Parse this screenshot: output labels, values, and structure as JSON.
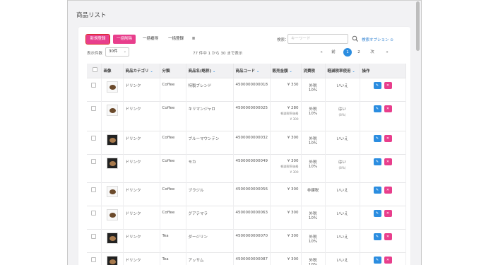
{
  "page_title": "商品リスト",
  "toolbar": {
    "new_label": "新規登録",
    "bulk_delete_label": "一括削除",
    "bulk_edit_label": "一括複得",
    "bulk_register_label": "一括登録",
    "columns_label": "Ⅲ"
  },
  "search": {
    "label": "検索：",
    "placeholder": "キーワード",
    "options_label": "検索オプション"
  },
  "per_page": {
    "label": "表示件数",
    "value": "30件"
  },
  "result_count": "77 件中 1 から 30 まで表示",
  "pagination": {
    "first": "«",
    "prev": "前",
    "pages": [
      "1",
      "2"
    ],
    "next": "次",
    "last": "»"
  },
  "table": {
    "headers": [
      "",
      "画像",
      "商品カテゴリ",
      "分類",
      "商品名(略称)",
      "商品コード",
      "販売金額",
      "消費税",
      "軽減税率使用",
      "操作"
    ],
    "rows": [
      {
        "category": "ドリンク",
        "class": "Coffee",
        "name": "特製ブレンド",
        "code": "4500000000018",
        "price": "¥ 330",
        "price_note": "",
        "price_note2": "",
        "tax": "外税",
        "tax_rate": "10%",
        "reduced": "いいえ",
        "reduced_note": "",
        "thumb": "light"
      },
      {
        "category": "ドリンク",
        "class": "Coffee",
        "name": "キリマンジャロ",
        "code": "4500000000025",
        "price": "¥ 280",
        "price_note": "軽減税率価格",
        "price_note2": "¥ 300",
        "tax": "外税",
        "tax_rate": "10%",
        "reduced": "はい",
        "reduced_note": "(8%)",
        "thumb": "light"
      },
      {
        "category": "ドリンク",
        "class": "Coffee",
        "name": "ブルーマウンテン",
        "code": "4500000000032",
        "price": "¥ 300",
        "price_note": "",
        "price_note2": "",
        "tax": "外税",
        "tax_rate": "10%",
        "reduced": "いいえ",
        "reduced_note": "",
        "thumb": "dark"
      },
      {
        "category": "ドリンク",
        "class": "Coffee",
        "name": "モカ",
        "code": "4500000000049",
        "price": "¥ 300",
        "price_note": "軽減税率価格",
        "price_note2": "¥ 300",
        "tax": "外税",
        "tax_rate": "10%",
        "reduced": "はい",
        "reduced_note": "(8%)",
        "thumb": "dark"
      },
      {
        "category": "ドリンク",
        "class": "Coffee",
        "name": "ブラジル",
        "code": "4500000000056",
        "price": "¥ 300",
        "price_note": "",
        "price_note2": "",
        "tax": "非課税",
        "tax_rate": "",
        "reduced": "いいえ",
        "reduced_note": "",
        "thumb": "light"
      },
      {
        "category": "ドリンク",
        "class": "Coffee",
        "name": "グアテマラ",
        "code": "4500000000063",
        "price": "¥ 300",
        "price_note": "",
        "price_note2": "",
        "tax": "外税",
        "tax_rate": "10%",
        "reduced": "いいえ",
        "reduced_note": "",
        "thumb": "light"
      },
      {
        "category": "ドリンク",
        "class": "Tea",
        "name": "ダージリン",
        "code": "4500000000070",
        "price": "¥ 300",
        "price_note": "",
        "price_note2": "",
        "tax": "外税",
        "tax_rate": "10%",
        "reduced": "いいえ",
        "reduced_note": "",
        "thumb": "dark"
      },
      {
        "category": "ドリンク",
        "class": "Tea",
        "name": "アッサム",
        "code": "4500000000087",
        "price": "¥ 300",
        "price_note": "",
        "price_note2": "",
        "tax": "外税",
        "tax_rate": "10%",
        "reduced": "いいえ",
        "reduced_note": "",
        "thumb": "dark"
      }
    ]
  },
  "colors": {
    "accent_pink": "#e83e8c",
    "accent_blue": "#2b8de0",
    "highlight_red": "#d9261c"
  }
}
